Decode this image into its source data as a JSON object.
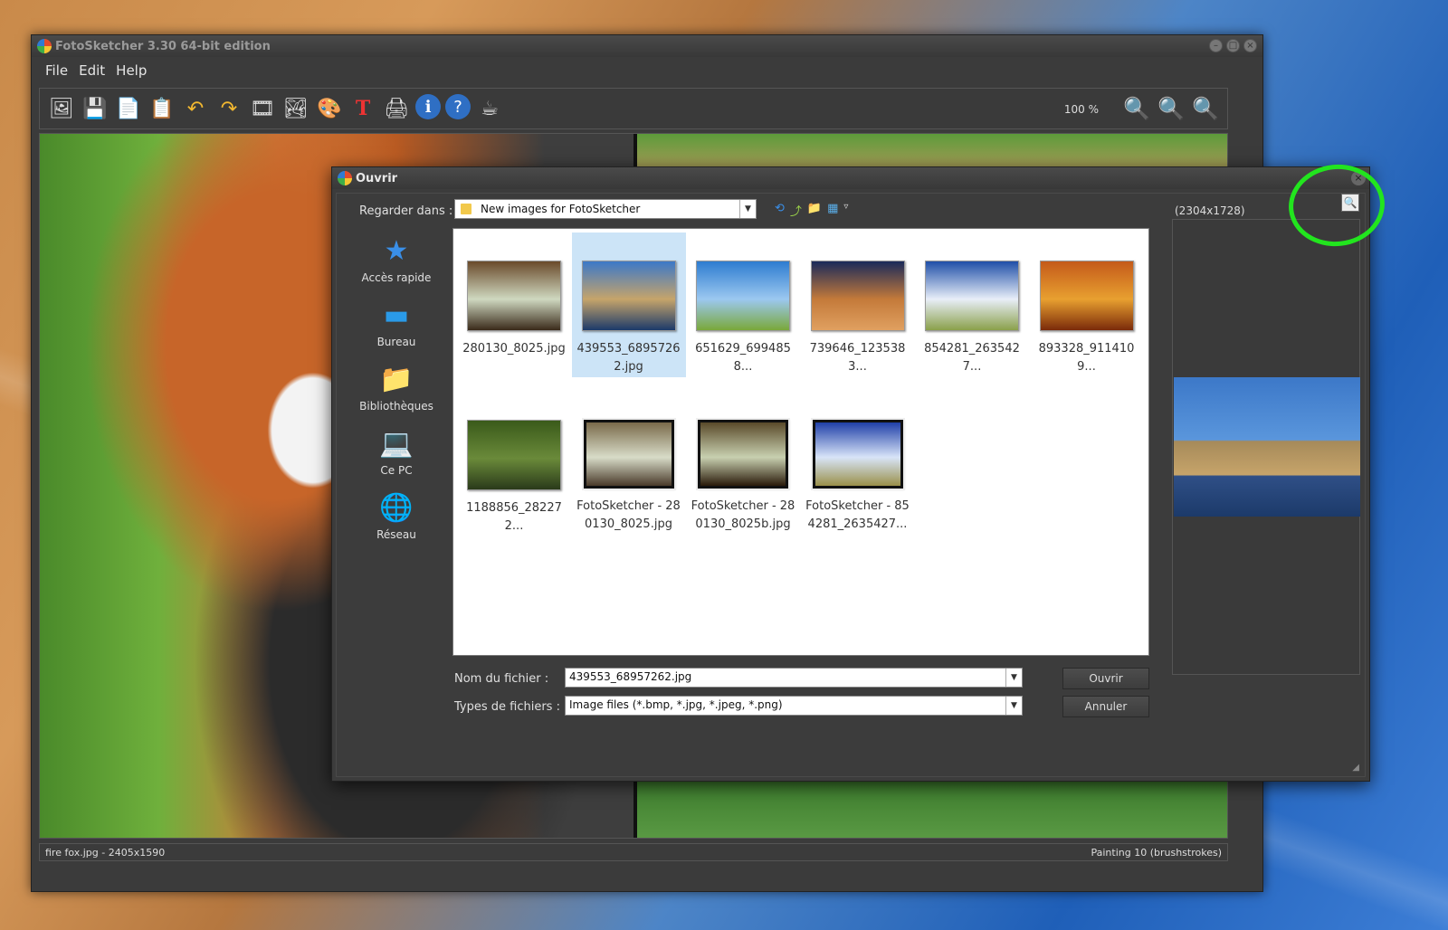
{
  "window": {
    "title": "FotoSketcher 3.30 64-bit edition",
    "minimize": "–",
    "maximize": "□",
    "close": "×"
  },
  "menu": {
    "file": "File",
    "edit": "Edit",
    "help": "Help"
  },
  "toolbar": {
    "zoom_level": "100 %",
    "icons": [
      "open-icon",
      "save-icon",
      "copy-icon",
      "paste-icon",
      "undo-icon",
      "redo-icon",
      "film-icon",
      "image-icon",
      "palette-icon",
      "text-icon",
      "print-icon",
      "info-icon",
      "help-icon",
      "coffee-icon"
    ],
    "glyphs": [
      "🖼",
      "💾",
      "📄",
      "📋",
      "↶",
      "↷",
      "🎞",
      "🏞",
      "🎨",
      "T",
      "🖨",
      "ℹ",
      "?",
      "☕"
    ],
    "zoom_glyphs": [
      "🔍",
      "🔍",
      "🔍"
    ]
  },
  "status": {
    "left": "fire fox.jpg - 2405x1590",
    "right": "Painting 10 (brushstrokes)"
  },
  "dialog": {
    "title": "Ouvrir",
    "close": "×",
    "look_in_label": "Regarder dans :",
    "look_in_value": "New images for FotoSketcher",
    "dropdown_arrow": "▼",
    "nav_glyphs": [
      "⟲",
      "⤴",
      "📁",
      "▦",
      "▿"
    ],
    "places": [
      {
        "label": "Accès rapide",
        "glyph": "★",
        "color": "#3a8fe8"
      },
      {
        "label": "Bureau",
        "glyph": "▬",
        "color": "#2a9ae8"
      },
      {
        "label": "Bibliothèques",
        "glyph": "📁",
        "color": "#f2c94c"
      },
      {
        "label": "Ce PC",
        "glyph": "💻",
        "color": "#5aaee8"
      },
      {
        "label": "Réseau",
        "glyph": "🌐",
        "color": "#5aaee8"
      }
    ],
    "files": [
      {
        "name": "280130_8025.jpg",
        "colors": [
          "#6a4a2a",
          "#cfd8c0",
          "#3a2a1a"
        ],
        "framed": false,
        "selected": false
      },
      {
        "name": "439553_68957262.jpg",
        "colors": [
          "#3c78c8",
          "#c6a46a",
          "#1c3a6a"
        ],
        "framed": false,
        "selected": true
      },
      {
        "name": "651629_6994858...",
        "colors": [
          "#2d7cd0",
          "#9cc8f0",
          "#7aa83a"
        ],
        "framed": false,
        "selected": false
      },
      {
        "name": "739646_1235383...",
        "colors": [
          "#1a2a5a",
          "#c47a3a",
          "#e0a060"
        ],
        "framed": false,
        "selected": false
      },
      {
        "name": "854281_2635427...",
        "colors": [
          "#1f4fa8",
          "#e8eef8",
          "#8aa04a"
        ],
        "framed": false,
        "selected": false
      },
      {
        "name": "893328_9114109...",
        "colors": [
          "#c45a1a",
          "#e8a030",
          "#7a2a0a"
        ],
        "framed": false,
        "selected": false
      },
      {
        "name": "1188856_282272...",
        "colors": [
          "#3a5a1a",
          "#6a8a3a",
          "#2a3a1a"
        ],
        "framed": false,
        "selected": false
      },
      {
        "name": "FotoSketcher - 280130_8025.jpg",
        "colors": [
          "#7a6a4a",
          "#d8dcc8",
          "#4a3a2a"
        ],
        "framed": true,
        "selected": false
      },
      {
        "name": "FotoSketcher - 280130_8025b.jpg",
        "colors": [
          "#5a4a2a",
          "#c8d0b0",
          "#2a1a0a"
        ],
        "framed": true,
        "selected": false
      },
      {
        "name": "FotoSketcher - 854281_2635427...",
        "colors": [
          "#1f3fa8",
          "#d8e4f8",
          "#9a904a"
        ],
        "framed": true,
        "selected": false
      }
    ],
    "filename_label": "Nom du fichier :",
    "filename_value": "439553_68957262.jpg",
    "filetype_label": "Types de fichiers :",
    "filetype_value": "Image files (*.bmp, *.jpg, *.jpeg, *.png)",
    "open_button": "Ouvrir",
    "cancel_button": "Annuler",
    "preview_size": "(2304x1728)",
    "preview_toggle_glyph": "🔍",
    "resize_grip": "◢"
  },
  "colors": {
    "highlight": "#22e51e",
    "selected": "#cce4f7"
  }
}
